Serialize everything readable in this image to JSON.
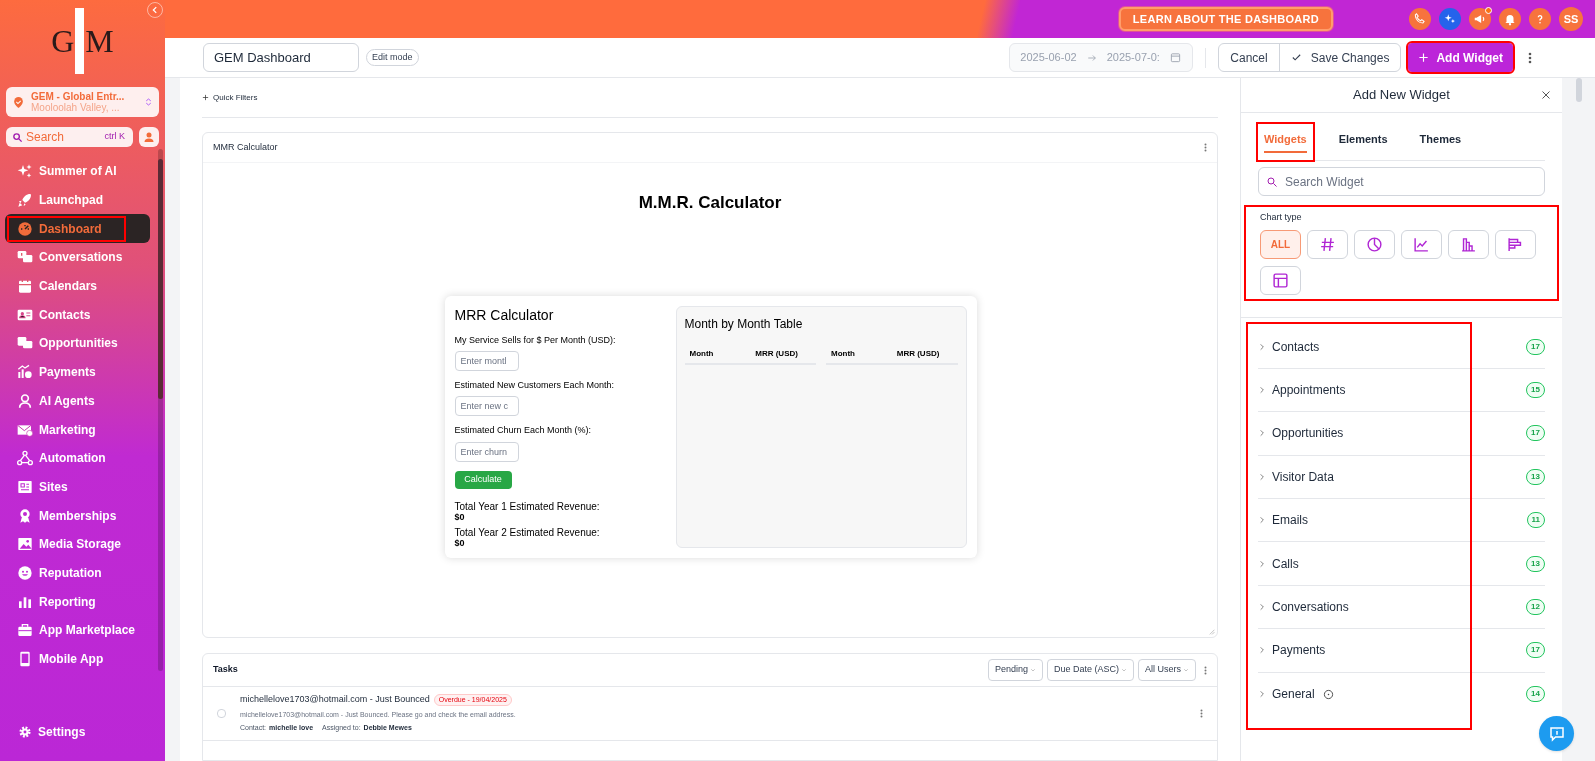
{
  "sidebar": {
    "logo": [
      "G",
      "M"
    ],
    "location": {
      "name": "GEM - Global Entr...",
      "address": "Mooloolah Valley, ..."
    },
    "search": {
      "placeholder": "Search",
      "shortcut": "ctrl K"
    },
    "items": [
      {
        "label": "Summer of AI",
        "selected": false,
        "highlighted": false
      },
      {
        "label": "Launchpad",
        "selected": false,
        "highlighted": false
      },
      {
        "label": "Dashboard",
        "selected": true,
        "highlighted": true
      },
      {
        "label": "Conversations",
        "selected": false,
        "highlighted": false
      },
      {
        "label": "Calendars",
        "selected": false,
        "highlighted": false
      },
      {
        "label": "Contacts",
        "selected": false,
        "highlighted": false
      },
      {
        "label": "Opportunities",
        "selected": false,
        "highlighted": false
      },
      {
        "label": "Payments",
        "selected": false,
        "highlighted": false
      },
      {
        "label": "AI Agents",
        "selected": false,
        "highlighted": false
      },
      {
        "label": "Marketing",
        "selected": false,
        "highlighted": false
      },
      {
        "label": "Automation",
        "selected": false,
        "highlighted": false
      },
      {
        "label": "Sites",
        "selected": false,
        "highlighted": false
      },
      {
        "label": "Memberships",
        "selected": false,
        "highlighted": false
      },
      {
        "label": "Media Storage",
        "selected": false,
        "highlighted": false
      },
      {
        "label": "Reputation",
        "selected": false,
        "highlighted": false
      },
      {
        "label": "Reporting",
        "selected": false,
        "highlighted": false
      },
      {
        "label": "App Marketplace",
        "selected": false,
        "highlighted": false
      },
      {
        "label": "Mobile App",
        "selected": false,
        "highlighted": false
      }
    ],
    "settings": "Settings"
  },
  "top_bar": {
    "learn_button": "LEARN ABOUT THE DASHBOARD",
    "avatar": "SS"
  },
  "toolbar": {
    "dashboard_name": "GEM Dashboard",
    "mode_badge": "Edit mode",
    "date_from": "2025-06-02",
    "date_to": "2025-07-0:",
    "cancel": "Cancel",
    "save": "Save Changes",
    "add_widget": {
      "label": "Add Widget",
      "highlighted": true
    }
  },
  "dashboard": {
    "quick_filters": "Quick Filters",
    "mmr_widget": {
      "title": "MMR Calculator",
      "heading": "M.M.R. Calculator",
      "form": {
        "title": "MRR Calculator",
        "fields": [
          {
            "label": "My Service Sells for $ Per Month (USD):",
            "placeholder": "Enter montl"
          },
          {
            "label": "Estimated New Customers Each Month:",
            "placeholder": "Enter new c"
          },
          {
            "label": "Estimated Churn Each Month (%):",
            "placeholder": "Enter churn"
          }
        ],
        "button": "Calculate",
        "totals": [
          {
            "label": "Total Year 1 Estimated Revenue:",
            "value": "$0"
          },
          {
            "label": "Total Year 2 Estimated Revenue:",
            "value": "$0"
          }
        ]
      },
      "table": {
        "title": "Month by Month Table",
        "columns": [
          "Month",
          "MRR (USD)",
          "Month",
          "MRR (USD)"
        ]
      }
    },
    "tasks": {
      "title": "Tasks",
      "filters": [
        "Pending",
        "Due Date (ASC)",
        "All Users"
      ],
      "rows": [
        {
          "title": "michellelove1703@hotmail.com - Just Bounced",
          "badge": "Overdue - 19/04/2025",
          "description": "michellelove1703@hotmail.com - Just Bounced. Please go and check the email address.",
          "contact_label": "Contact:",
          "contact": "michelle love",
          "assigned_label": "Assigned to:",
          "assigned": "Debbie Mewes",
          "checked": false
        }
      ]
    }
  },
  "panel": {
    "title": "Add New Widget",
    "tabs": [
      {
        "label": "Widgets",
        "selected": true,
        "highlighted": true
      },
      {
        "label": "Elements",
        "selected": false,
        "highlighted": false
      },
      {
        "label": "Themes",
        "selected": false,
        "highlighted": false
      }
    ],
    "search_placeholder": "Search Widget",
    "chart_type_label": "Chart type",
    "chart_types_highlighted": true,
    "chart_types": [
      {
        "kind": "text",
        "label": "ALL",
        "selected": true
      },
      {
        "kind": "number",
        "selected": false
      },
      {
        "kind": "pie",
        "selected": false
      },
      {
        "kind": "line",
        "selected": false
      },
      {
        "kind": "bar",
        "selected": false
      },
      {
        "kind": "hbar",
        "selected": false
      },
      {
        "kind": "table",
        "selected": false
      }
    ],
    "categories_highlighted": true,
    "categories": [
      {
        "label": "Contacts",
        "count": "17",
        "info": false
      },
      {
        "label": "Appointments",
        "count": "15",
        "info": false
      },
      {
        "label": "Opportunities",
        "count": "17",
        "info": false
      },
      {
        "label": "Visitor Data",
        "count": "13",
        "info": false
      },
      {
        "label": "Emails",
        "count": "11",
        "info": false
      },
      {
        "label": "Calls",
        "count": "13",
        "info": false
      },
      {
        "label": "Conversations",
        "count": "12",
        "info": false
      },
      {
        "label": "Payments",
        "count": "17",
        "info": false
      },
      {
        "label": "General",
        "count": "14",
        "info": true
      }
    ]
  }
}
